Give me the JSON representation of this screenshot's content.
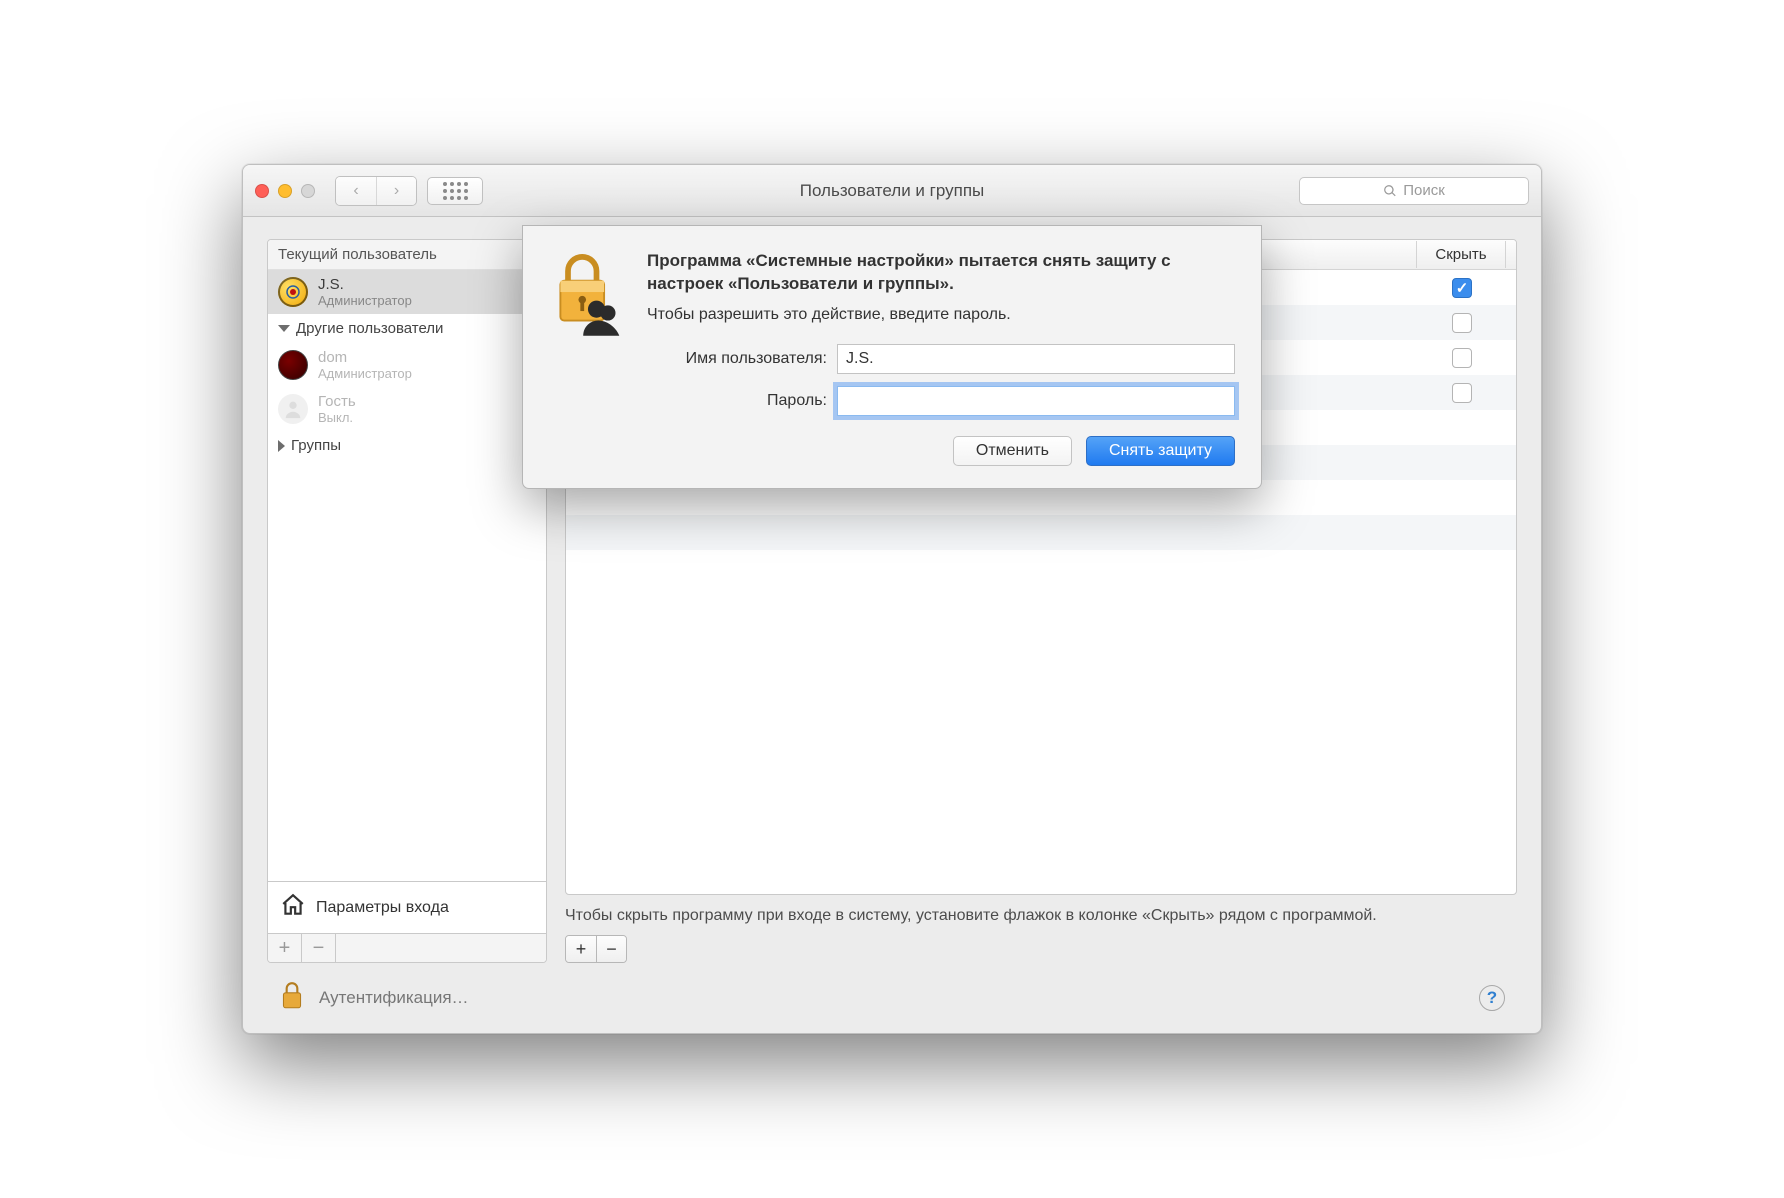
{
  "window": {
    "title": "Пользователи и группы",
    "search_placeholder": "Поиск"
  },
  "sidebar": {
    "current_user_header": "Текущий пользователь",
    "other_users_header": "Другие пользователи",
    "groups_header": "Группы",
    "login_options": "Параметры входа",
    "users": [
      {
        "name": "J.S.",
        "role": "Администратор",
        "selected": true,
        "avatar": "yellow"
      },
      {
        "name": "dom",
        "role": "Администратор",
        "selected": false,
        "avatar": "red"
      },
      {
        "name": "Гость",
        "role": "Выкл.",
        "selected": false,
        "avatar": "grey"
      }
    ],
    "plus": "+",
    "minus": "−"
  },
  "main": {
    "hide_column": "Скрыть",
    "rows": [
      {
        "checked": true
      },
      {
        "checked": false
      },
      {
        "checked": false
      },
      {
        "checked": false
      }
    ],
    "hint": "Чтобы скрыть программу при входе в систему, установите флажок в колонке «Скрыть» рядом с программой.",
    "plus": "+",
    "minus": "−"
  },
  "footer": {
    "auth_text": "Аутентификация…",
    "help": "?"
  },
  "dialog": {
    "title": "Программа «Системные настройки» пытается снять защиту с настроек «Пользователи и группы».",
    "subtitle": "Чтобы разрешить это действие, введите пароль.",
    "username_label": "Имя пользователя:",
    "username_value": "J.S.",
    "password_label": "Пароль:",
    "password_value": "",
    "cancel": "Отменить",
    "unlock": "Снять защиту"
  }
}
